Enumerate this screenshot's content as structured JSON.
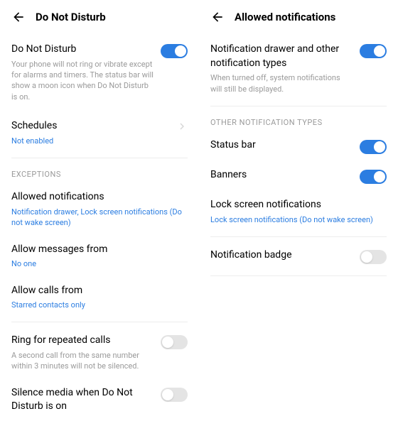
{
  "left": {
    "title": "Do Not Disturb",
    "dnd": {
      "label": "Do Not Disturb",
      "desc": "Your phone will not ring or vibrate except for alarms and timers. The status bar will show a moon icon when Do Not Disturb is on.",
      "on": true
    },
    "schedules": {
      "label": "Schedules",
      "value": "Not enabled"
    },
    "exceptions_header": "EXCEPTIONS",
    "allowed": {
      "label": "Allowed notifications",
      "value": "Notification drawer, Lock screen notifications (Do not wake screen)"
    },
    "messages": {
      "label": "Allow messages from",
      "value": "No one"
    },
    "calls": {
      "label": "Allow calls from",
      "value": "Starred contacts only"
    },
    "repeated": {
      "label": "Ring for repeated calls",
      "desc": "A second call from the same number within 3 minutes will not be silenced.",
      "on": false
    },
    "silence": {
      "label": "Silence media when Do Not Disturb is on",
      "on": false
    }
  },
  "right": {
    "title": "Allowed notifications",
    "drawer": {
      "label": "Notification drawer and other notification types",
      "desc": "When turned off, system notifications will still be displayed.",
      "on": true
    },
    "other_header": "OTHER NOTIFICATION TYPES",
    "statusbar": {
      "label": "Status bar",
      "on": true
    },
    "banners": {
      "label": "Banners",
      "on": true
    },
    "lockscreen": {
      "label": "Lock screen notifications",
      "value": "Lock screen notifications (Do not wake screen)"
    },
    "badge": {
      "label": "Notification badge",
      "on": false
    }
  }
}
